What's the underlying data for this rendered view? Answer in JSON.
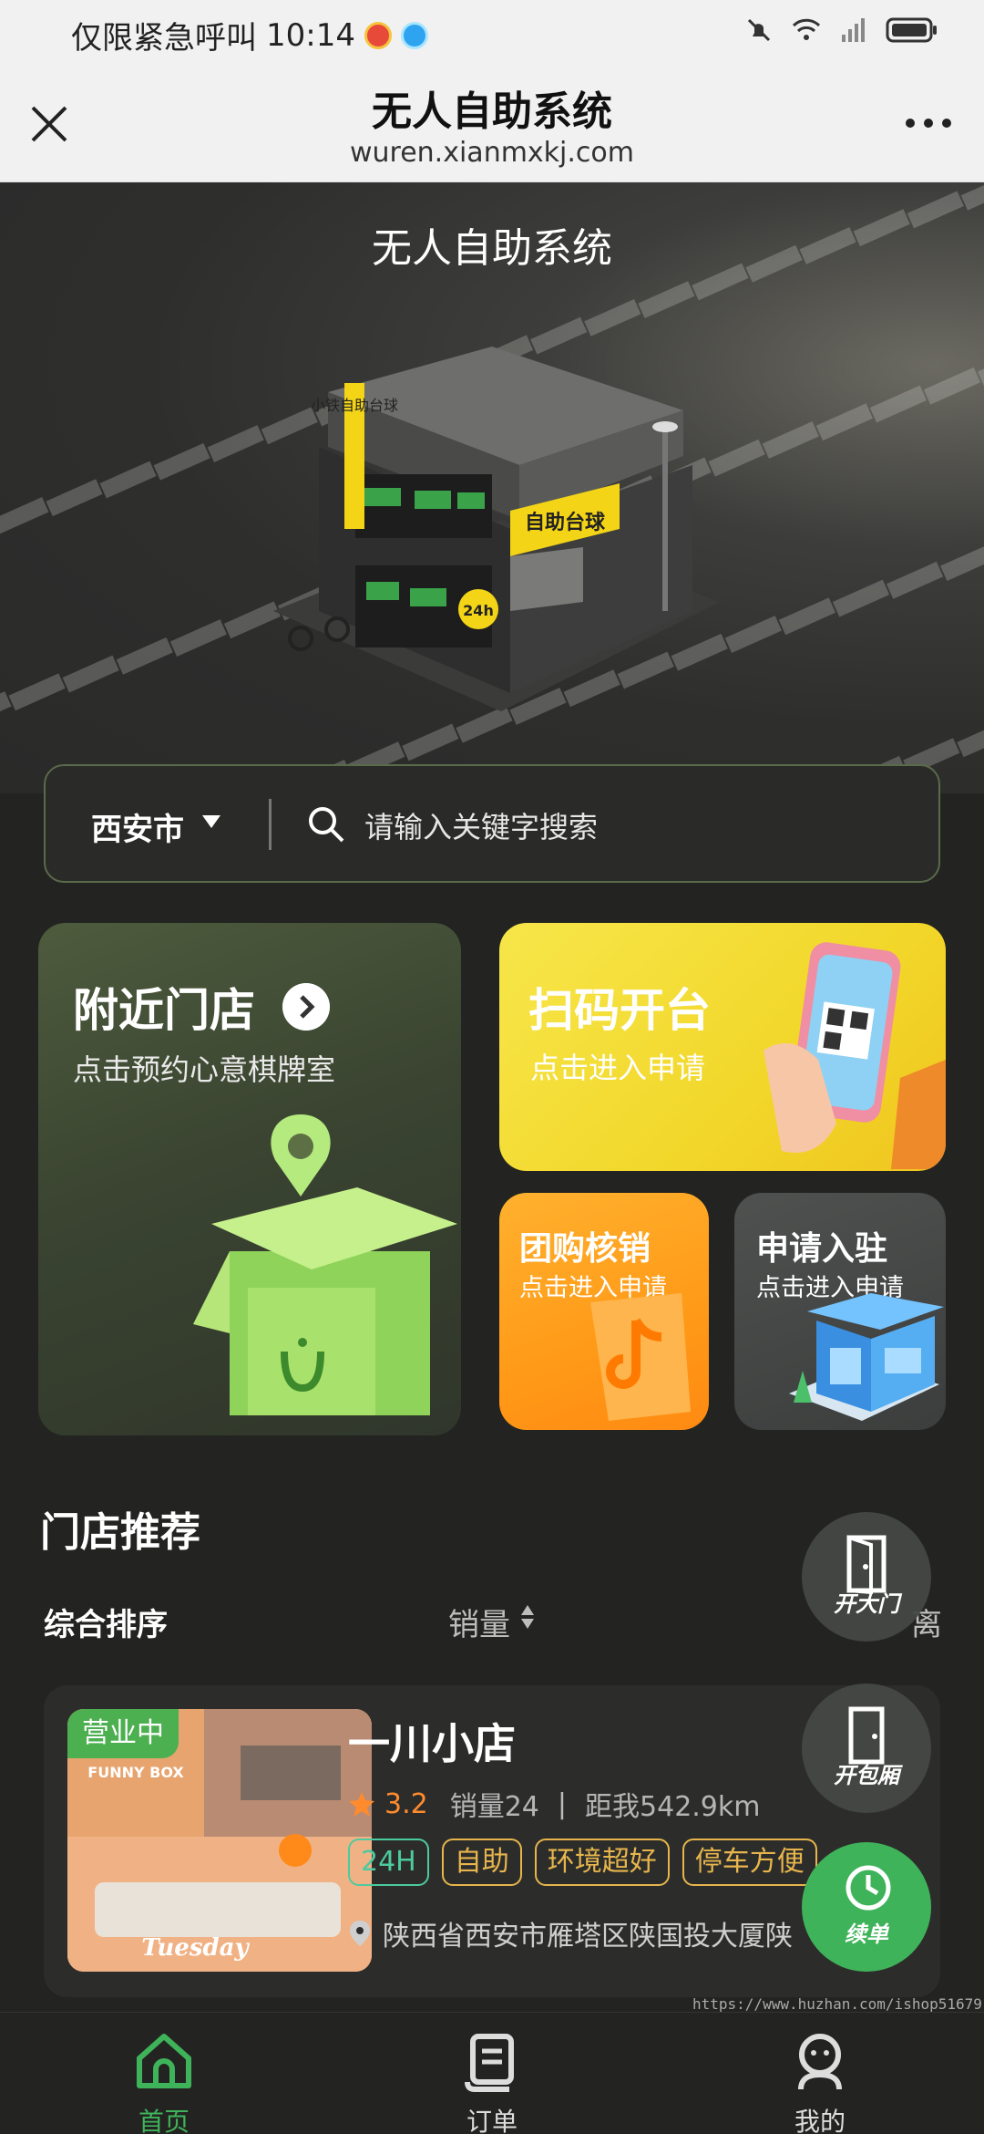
{
  "status_bar": {
    "carrier_text": "仅限紧急呼叫",
    "time": "10:14"
  },
  "browser": {
    "title": "无人自助系统",
    "url": "wuren.xianmxkj.com"
  },
  "hero": {
    "title": "无人自助系统",
    "sign_vertical": "小铁自助台球",
    "sign_front": "自助台球",
    "sign_24h": "24h"
  },
  "search": {
    "city": "西安市",
    "placeholder": "请输入关键字搜索"
  },
  "cards": {
    "nearby": {
      "title": "附近门店",
      "subtitle": "点击预约心意棋牌室"
    },
    "scan": {
      "title": "扫码开台",
      "subtitle": "点击进入申请"
    },
    "group": {
      "title": "团购核销",
      "subtitle": "点击进入申请"
    },
    "join": {
      "title": "申请入驻",
      "subtitle": "点击进入申请"
    }
  },
  "recommend": {
    "title": "门店推荐",
    "sort_main": "综合排序",
    "sort_sales": "销量",
    "sort_distance": "离"
  },
  "shop": {
    "badge": "营业中",
    "name": "一川小店",
    "rating": "3.2",
    "sales": "销量24",
    "separator": "|",
    "distance": "距我542.9km",
    "tags": [
      "24H",
      "自助",
      "环境超好",
      "停车方便"
    ],
    "address": "陕西省西安市雁塔区陕国投大厦陕",
    "thumb_text_top": "FUNNY BOX",
    "thumb_text_bottom": "Tuesday"
  },
  "fabs": {
    "gate": "开大门",
    "room": "开包厢",
    "renew": "续单"
  },
  "watermark": "https://www.huzhan.com/ishop51679",
  "bottom_nav": {
    "home": "首页",
    "order": "订单",
    "mine": "我的"
  },
  "colors": {
    "accent_green": "#3fb35a",
    "tag_green": "#4ccaa0",
    "tag_gold": "#e7b54c",
    "rating_orange": "#ff8b2d"
  }
}
